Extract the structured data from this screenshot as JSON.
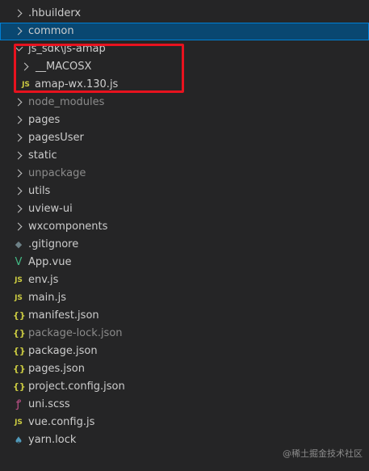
{
  "explorer": {
    "hbuilderx": ".hbuilderx",
    "common": "common",
    "js_sdk": "js_sdk\\js-amap",
    "macosx": "__MACOSX",
    "amap_file": "amap-wx.130.js",
    "node_modules": "node_modules",
    "pages": "pages",
    "pagesUser": "pagesUser",
    "static": "static",
    "unpackage": "unpackage",
    "utils": "utils",
    "uview_ui": "uview-ui",
    "wxcomponents": "wxcomponents",
    "gitignore": ".gitignore",
    "app_vue": "App.vue",
    "env_js": "env.js",
    "main_js": "main.js",
    "manifest_json": "manifest.json",
    "package_lock_json": "package-lock.json",
    "package_json": "package.json",
    "pages_json": "pages.json",
    "project_config_json": "project.config.json",
    "uni_scss": "uni.scss",
    "vue_config_js": "vue.config.js",
    "yarn_lock": "yarn.lock"
  },
  "icons": {
    "js": "JS",
    "json": "{}",
    "vue": "V",
    "git": "◆",
    "scss": "ꝭ",
    "yarn": "♠"
  },
  "watermark": "@稀土掘金技术社区",
  "colors": {
    "background": "#252526",
    "selection": "#094771",
    "highlight_box": "#e8121e",
    "js_icon": "#cbcb41",
    "vue_icon": "#42b883"
  }
}
